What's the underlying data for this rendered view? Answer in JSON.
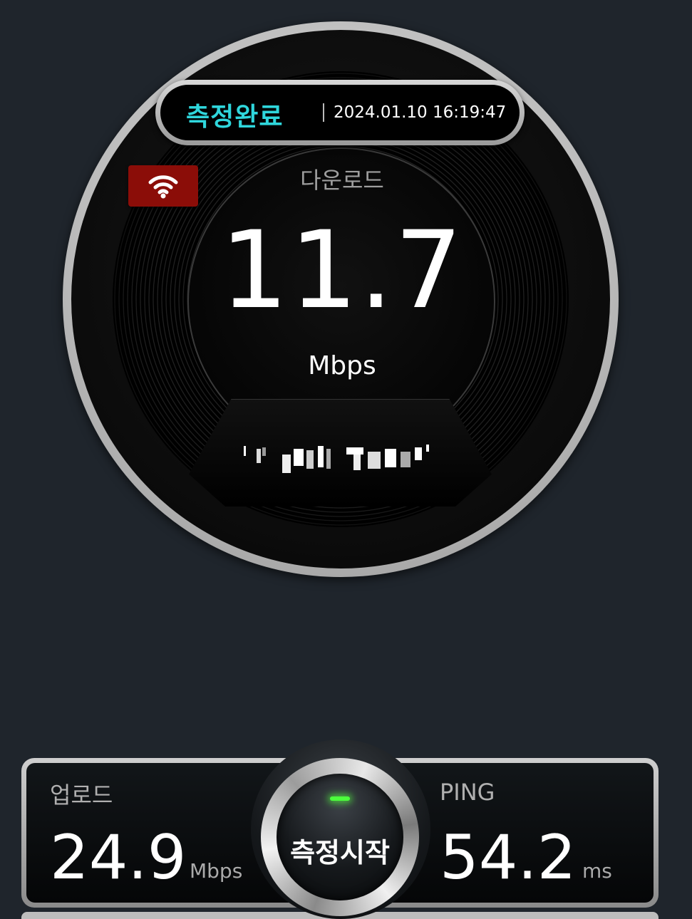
{
  "status": {
    "label": "측정완료",
    "timestamp": "2024.01.10 16:19:47"
  },
  "connection": {
    "icon": "wifi-icon",
    "badge_color": "#8b0d08"
  },
  "download": {
    "label": "다운로드",
    "value": "11.7",
    "unit": "Mbps"
  },
  "upload": {
    "label": "업로드",
    "value": "24.9",
    "unit": "Mbps"
  },
  "ping": {
    "label": "PING",
    "value": "54.2",
    "unit": "ms"
  },
  "start_button": {
    "label": "측정시작",
    "led_color": "#4cff3c"
  },
  "colors": {
    "accent": "#2fd6dc",
    "background": "#1f252c"
  }
}
